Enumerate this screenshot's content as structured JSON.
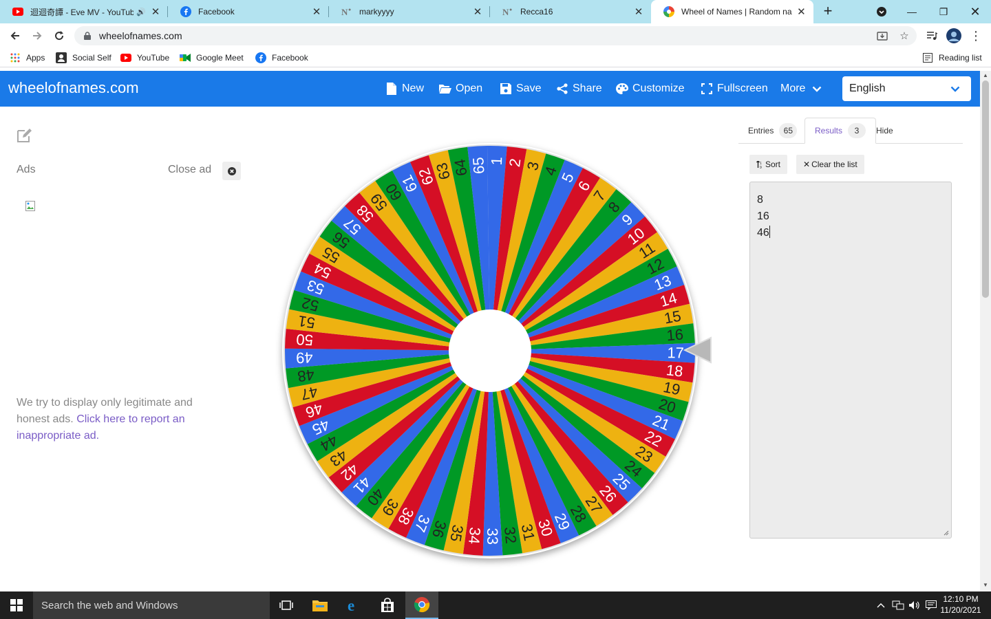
{
  "browser": {
    "tabs": [
      {
        "title": "迴迴奇譚 - Eve MV - YouTub",
        "icon": "youtube-icon",
        "audio": true
      },
      {
        "title": "Facebook",
        "icon": "facebook-icon"
      },
      {
        "title": "markyyyy",
        "icon": "notion-icon"
      },
      {
        "title": "Recca16",
        "icon": "notion-icon"
      },
      {
        "title": "Wheel of Names | Random nam",
        "icon": "wheelofnames-icon",
        "active": true
      }
    ],
    "url": "wheelofnames.com",
    "bookmarks": [
      {
        "label": "Apps",
        "icon": "apps-grid-icon"
      },
      {
        "label": "Social Self",
        "icon": "social-self-icon"
      },
      {
        "label": "YouTube",
        "icon": "youtube-icon"
      },
      {
        "label": "Google Meet",
        "icon": "google-meet-icon"
      },
      {
        "label": "Facebook",
        "icon": "facebook-icon"
      }
    ],
    "reading_list": "Reading list"
  },
  "site": {
    "brand": "wheelofnames.com",
    "menu": [
      {
        "label": "New",
        "icon": "file-icon"
      },
      {
        "label": "Open",
        "icon": "folder-open-icon"
      },
      {
        "label": "Save",
        "icon": "save-icon"
      },
      {
        "label": "Share",
        "icon": "share-icon"
      },
      {
        "label": "Customize",
        "icon": "palette-icon"
      },
      {
        "label": "Fullscreen",
        "icon": "fullscreen-icon"
      },
      {
        "label": "More",
        "icon": "chevron-down-icon"
      }
    ],
    "language": "English",
    "brand_color": "#1a7ae8"
  },
  "ads": {
    "label": "Ads",
    "close_label": "Close ad",
    "note_text": "We try to display only legitimate and honest ads.",
    "note_link": "Click here to report an inappropriate ad."
  },
  "wheel": {
    "entry_count": 65,
    "selected": "46",
    "colors": [
      "#3369e8",
      "#d50f25",
      "#eeb211",
      "#009925"
    ],
    "label_colors": [
      "#ffffff",
      "#ffffff",
      "#222222",
      "#222222"
    ]
  },
  "panel": {
    "tabs": [
      {
        "label": "Entries",
        "count": "65"
      },
      {
        "label": "Results",
        "count": "3",
        "active": true
      },
      {
        "label": "Hide"
      }
    ],
    "sort_label": "Sort",
    "clear_label": "Clear the list",
    "results": [
      "8",
      "16",
      "46"
    ]
  },
  "taskbar": {
    "search_placeholder": "Search the web and Windows",
    "time": "12:10 PM",
    "date": "11/20/2021"
  }
}
